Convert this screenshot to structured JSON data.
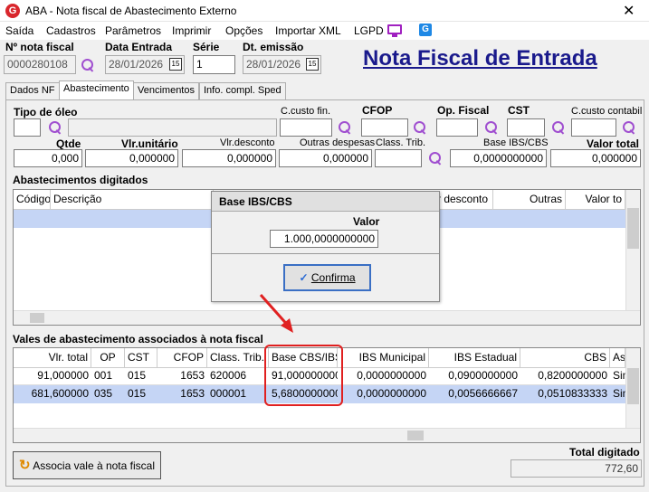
{
  "window": {
    "title": "ABA - Nota fiscal de Abastecimento Externo",
    "close": "✕"
  },
  "menu": [
    "Saída",
    "Cadastros",
    "Parâmetros",
    "Imprimir",
    "Opções",
    "Importar XML",
    "LGPD"
  ],
  "header": {
    "nota_label": "Nº nota fiscal",
    "nota_value": "0000280108",
    "data_entrada_label": "Data Entrada",
    "data_entrada_value": "28/01/2026",
    "serie_label": "Série",
    "serie_value": "1",
    "dt_emissao_label": "Dt. emissão",
    "dt_emissao_value": "28/01/2026",
    "page_title": "Nota Fiscal de Entrada",
    "cal_icon": "15"
  },
  "tabs": [
    "Dados NF",
    "Abastecimento",
    "Vencimentos",
    "Info. compl. Sped"
  ],
  "form": {
    "tipo_oleo": "Tipo de óleo",
    "ccusto_fin": "C.custo fin.",
    "cfop": "CFOP",
    "op_fiscal": "Op. Fiscal",
    "cst": "CST",
    "ccusto_contabil": "C.custo contabil",
    "qtde": "Qtde",
    "vlr_unitario": "Vlr.unitário",
    "vlr_desconto": "Vlr.desconto",
    "outras_despesas": "Outras despesas",
    "class_trib": "Class. Trib.",
    "base_ibs_cbs": "Base IBS/CBS",
    "valor_total": "Valor total",
    "qtde_value": "0,000",
    "vlr_unitario_value": "0,000000",
    "vlr_desconto_value": "0,000000",
    "outras_despesas_value": "0,000000",
    "base_value": "0,0000000000",
    "valor_total_value": "0,000000"
  },
  "abastecimentos": {
    "title": "Abastecimentos digitados",
    "columns": [
      "Código",
      "Descrição",
      "r desconto",
      "Outras",
      "Valor to"
    ]
  },
  "modal": {
    "title": "Base IBS/CBS",
    "valor_label": "Valor",
    "valor_value": "1.000,0000000000",
    "confirm_label": "Confirma"
  },
  "vales": {
    "title": "Vales de abastecimento associados à nota fiscal",
    "columns": [
      "Vlr. total",
      "OP",
      "CST",
      "CFOP",
      "Class. Trib.",
      "Base CBS/IBS",
      "IBS Municipal",
      "IBS Estadual",
      "CBS",
      "Ass"
    ],
    "rows": [
      [
        "91,000000",
        "001",
        "015",
        "1653",
        "620006",
        "91,0000000000",
        "0,0000000000",
        "0,0900000000",
        "0,8200000000",
        "Sim"
      ],
      [
        "681,600000",
        "035",
        "015",
        "1653",
        "000001",
        "5,6800000000",
        "0,0000000000",
        "0,0056666667",
        "0,0510833333",
        "Sim"
      ]
    ]
  },
  "footer": {
    "associa_label": "Associa vale à nota fiscal",
    "total_label": "Total digitado",
    "total_value": "772,60"
  }
}
